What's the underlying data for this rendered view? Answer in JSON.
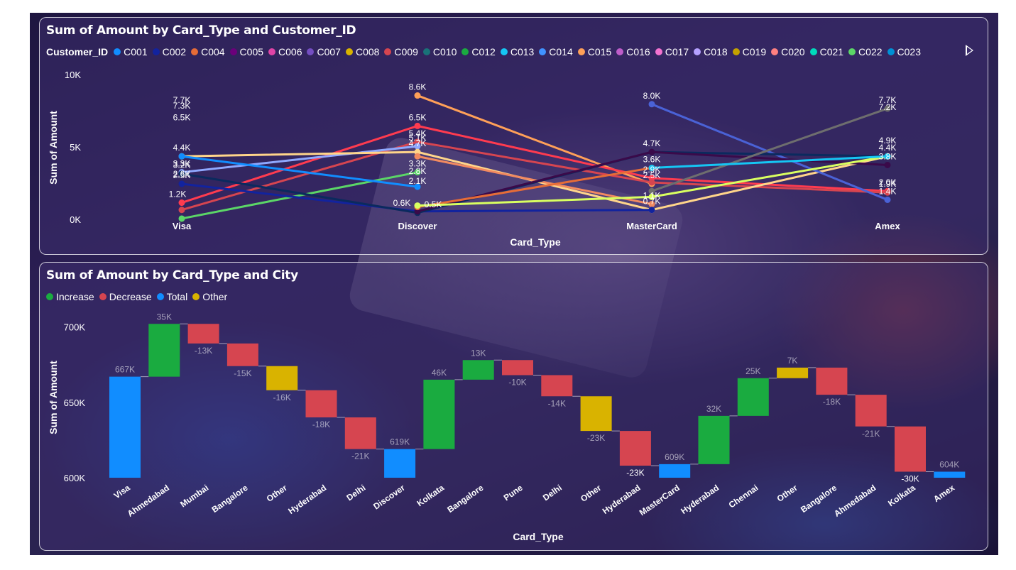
{
  "charts": {
    "line": {
      "title": "Sum of Amount by Card_Type and Customer_ID",
      "legend_title": "Customer_ID"
    },
    "waterfall": {
      "title": "Sum of Amount by Card_Type and City"
    }
  },
  "chart_data": [
    {
      "type": "line",
      "title": "Sum of Amount by Card_Type and Customer_ID",
      "xlabel": "Card_Type",
      "ylabel": "Sum of Amount",
      "categories": [
        "Visa",
        "Discover",
        "MasterCard",
        "Amex"
      ],
      "ylim": [
        0,
        10000
      ],
      "y_ticks": [
        "0K",
        "5K",
        "10K"
      ],
      "legend_title": "Customer_ID",
      "legend_position": "top",
      "legend": [
        {
          "name": "C001",
          "color": "#118DFF"
        },
        {
          "name": "C002",
          "color": "#12239E"
        },
        {
          "name": "C004",
          "color": "#E66C37"
        },
        {
          "name": "C005",
          "color": "#6B007B"
        },
        {
          "name": "C006",
          "color": "#E044A7"
        },
        {
          "name": "C007",
          "color": "#744EC2"
        },
        {
          "name": "C008",
          "color": "#D9B300"
        },
        {
          "name": "C009",
          "color": "#D64550"
        },
        {
          "name": "C010",
          "color": "#197278"
        },
        {
          "name": "C012",
          "color": "#1AAB40"
        },
        {
          "name": "C013",
          "color": "#15C6F4"
        },
        {
          "name": "C014",
          "color": "#4092FF"
        },
        {
          "name": "C015",
          "color": "#FFA058"
        },
        {
          "name": "C016",
          "color": "#BE5DC9"
        },
        {
          "name": "C017",
          "color": "#F472D0"
        },
        {
          "name": "C018",
          "color": "#B5A1FF"
        },
        {
          "name": "C019",
          "color": "#C4A200"
        },
        {
          "name": "C020",
          "color": "#FF8080"
        },
        {
          "name": "C021",
          "color": "#00DBBC"
        },
        {
          "name": "C022",
          "color": "#5BD667"
        },
        {
          "name": "C023",
          "color": "#0091D5"
        }
      ],
      "series": [
        {
          "color": "#FFA058",
          "values": [
            null,
            8600,
            2500,
            null
          ]
        },
        {
          "color": "#FF3B4F",
          "values": [
            1200,
            6500,
            2900,
            2000
          ]
        },
        {
          "color": "#D64550",
          "values": [
            700,
            5400,
            2600,
            1900
          ]
        },
        {
          "color": "#8FA8FF",
          "values": [
            3300,
            5100,
            null,
            null
          ]
        },
        {
          "color": "#FFD58A",
          "values": [
            4400,
            4700,
            700,
            4400
          ]
        },
        {
          "color": "#F28A60",
          "values": [
            null,
            4400,
            1100,
            null
          ]
        },
        {
          "color": "#4A62D6",
          "values": [
            null,
            null,
            8000,
            1400
          ]
        },
        {
          "color": "#5BD667",
          "values": [
            100,
            3300,
            null,
            null
          ]
        },
        {
          "color": "#118DFF",
          "values": [
            4400,
            2300,
            null,
            null
          ]
        },
        {
          "color": "#12239E",
          "values": [
            2500,
            600,
            700,
            null
          ]
        },
        {
          "color": "#0B2A5E",
          "values": [
            3200,
            500,
            4700,
            4400
          ]
        },
        {
          "color": "#3A0A4A",
          "values": [
            null,
            600,
            4700,
            3800
          ]
        },
        {
          "color": "#6E6E6E",
          "values": [
            null,
            null,
            2000,
            7700
          ]
        },
        {
          "color": "#E66C37",
          "values": [
            null,
            900,
            3600,
            null
          ]
        },
        {
          "color": "#D9FF60",
          "values": [
            null,
            1000,
            1600,
            4400
          ]
        },
        {
          "color": "#15C6F4",
          "values": [
            null,
            null,
            3600,
            4400
          ]
        }
      ],
      "data_labels": {
        "Visa": [
          "7.7K",
          "6.5K",
          "7.3K",
          "4.4K",
          "3.3K",
          "2.5K",
          "3.2K",
          "2.6K",
          "1.2K"
        ],
        "Discover": [
          "8.6K",
          "6.5K",
          "5.4K",
          "4.7K",
          "5.1K",
          "2.8K",
          "3.3K",
          "2.1K",
          "0.6K",
          "0.5K"
        ],
        "MasterCard": [
          "8.0K",
          "4.7K",
          "3.6K",
          "2.5K",
          "2.9K",
          "0.7K",
          "1.1K"
        ],
        "Amex": [
          "7.2K",
          "7.7K",
          "4.9K",
          "3.8K",
          "4.4K",
          "1.9K",
          "2.0K",
          "1.4K"
        ]
      }
    },
    {
      "type": "waterfall",
      "title": "Sum of Amount by Card_Type and City",
      "xlabel": "Card_Type",
      "ylabel": "Sum of Amount",
      "ylim": [
        600000,
        720000
      ],
      "y_ticks": [
        "600K",
        "650K",
        "700K"
      ],
      "legend_position": "top-left",
      "legend": [
        {
          "name": "Increase",
          "color": "#1AAB40"
        },
        {
          "name": "Decrease",
          "color": "#D64550"
        },
        {
          "name": "Total",
          "color": "#118DFF"
        },
        {
          "name": "Other",
          "color": "#D9B300"
        }
      ],
      "bars": [
        {
          "category": "Visa",
          "kind": "total",
          "end": 667000,
          "label": "667K"
        },
        {
          "category": "Ahmedabad",
          "kind": "increase",
          "delta": 35000,
          "label": "35K"
        },
        {
          "category": "Mumbai",
          "kind": "decrease",
          "delta": -13000,
          "label": "-13K"
        },
        {
          "category": "Bangalore",
          "kind": "decrease",
          "delta": -15000,
          "label": "-15K"
        },
        {
          "category": "Other",
          "kind": "other",
          "delta": -16000,
          "label": "-16K"
        },
        {
          "category": "Hyderabad",
          "kind": "decrease",
          "delta": -18000,
          "label": "-18K"
        },
        {
          "category": "Delhi",
          "kind": "decrease",
          "delta": -21000,
          "label": "-21K"
        },
        {
          "category": "Discover",
          "kind": "total",
          "end": 619000,
          "label": "619K"
        },
        {
          "category": "Kolkata",
          "kind": "increase",
          "delta": 46000,
          "label": "46K"
        },
        {
          "category": "Bangalore",
          "kind": "increase",
          "delta": 13000,
          "label": "13K"
        },
        {
          "category": "Pune",
          "kind": "decrease",
          "delta": -10000,
          "label": "-10K"
        },
        {
          "category": "Delhi",
          "kind": "decrease",
          "delta": -14000,
          "label": "-14K"
        },
        {
          "category": "Other",
          "kind": "other",
          "delta": -23000,
          "label": "-23K"
        },
        {
          "category": "Hyderabad",
          "kind": "decrease",
          "delta": -23000,
          "label": "-23K"
        },
        {
          "category": "MasterCard",
          "kind": "total",
          "end": 609000,
          "label": "609K"
        },
        {
          "category": "Hyderabad",
          "kind": "increase",
          "delta": 32000,
          "label": "32K"
        },
        {
          "category": "Chennai",
          "kind": "increase",
          "delta": 25000,
          "label": "25K"
        },
        {
          "category": "Other",
          "kind": "other",
          "delta": 7000,
          "label": "7K"
        },
        {
          "category": "Bangalore",
          "kind": "decrease",
          "delta": -18000,
          "label": "-18K"
        },
        {
          "category": "Ahmedabad",
          "kind": "decrease",
          "delta": -21000,
          "label": "-21K"
        },
        {
          "category": "Kolkata",
          "kind": "decrease",
          "delta": -30000,
          "label": "-30K"
        },
        {
          "category": "Amex",
          "kind": "total",
          "end": 604000,
          "label": "604K"
        }
      ]
    }
  ]
}
